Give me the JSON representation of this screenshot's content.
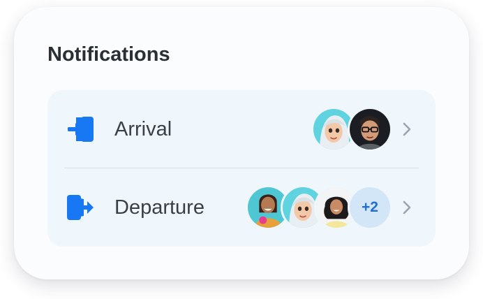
{
  "card": {
    "title": "Notifications"
  },
  "rows": [
    {
      "label": "Arrival",
      "icon": "arrival-icon",
      "avatars": [
        "avatar-animated-girl",
        "avatar-man-glasses"
      ]
    },
    {
      "label": "Departure",
      "icon": "departure-icon",
      "avatars": [
        "avatar-woman-dancing",
        "avatar-animated-girl",
        "avatar-woman-curly"
      ],
      "more": "+2"
    }
  ],
  "colors": {
    "accent": "#1877f2",
    "badge_bg": "#d3e6f8",
    "list_bg": "#eff6fc"
  }
}
